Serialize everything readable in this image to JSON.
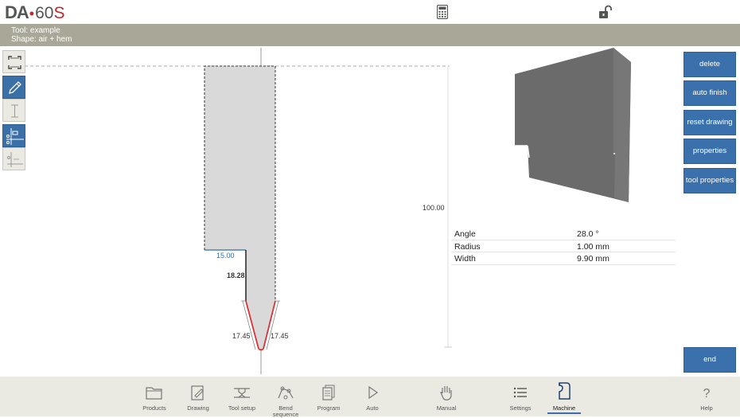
{
  "app": {
    "logo_da": "DA",
    "logo_dot": "•",
    "logo_model": "60",
    "logo_suffix": "S"
  },
  "info": {
    "tool_line": "Tool: example",
    "shape_line": "Shape: air + hem"
  },
  "icons": {
    "calculator": "calculator-icon",
    "lock": "unlocked-padlock-icon"
  },
  "drawing": {
    "dim_height": "100.00",
    "dim_width": "15.00",
    "dim_neck": "18.28",
    "dim_left_tip": "17.45",
    "dim_right_tip": "17.45"
  },
  "properties": [
    {
      "key": "Angle",
      "value": "28.0 °"
    },
    {
      "key": "Radius",
      "value": "1.00 mm"
    },
    {
      "key": "Width",
      "value": "9.90 mm"
    }
  ],
  "side_buttons": {
    "delete": "delete",
    "auto_finish": "auto finish",
    "reset_drawing": "reset drawing",
    "properties": "properties",
    "tool_properties": "tool properties",
    "end": "end"
  },
  "nav": [
    {
      "label": "Products"
    },
    {
      "label": "Drawing"
    },
    {
      "label": "Tool setup"
    },
    {
      "label": "Bend sequence"
    },
    {
      "label": "Program"
    },
    {
      "label": "Auto"
    },
    {
      "label": "Manual"
    },
    {
      "label": "Settings"
    },
    {
      "label": "Machine",
      "active": true
    },
    {
      "label": "Help"
    }
  ],
  "colors": {
    "accent_blue": "#3a70ab",
    "info_bar": "#a9a898",
    "bottom_bar": "#ebeae2",
    "tool_tip_red": "#d9333a",
    "dim_blue": "#2d6db5",
    "model_gray": "#6b6b6b"
  }
}
